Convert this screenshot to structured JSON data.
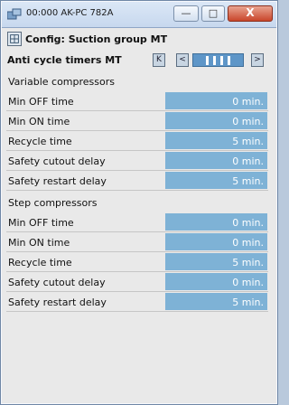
{
  "window": {
    "title": "00:000 AK-PC 782A",
    "min_glyph": "—",
    "max_glyph": "□",
    "close_glyph": "X"
  },
  "config": {
    "title": "Config: Suction group MT"
  },
  "nav": {
    "title": "Anti cycle timers MT",
    "first_glyph": "K",
    "prev_glyph": "<",
    "next_glyph": ">"
  },
  "variable": {
    "header": "Variable compressors",
    "rows": [
      {
        "label": "Min OFF time",
        "value": "0 min."
      },
      {
        "label": "Min ON time",
        "value": "0 min."
      },
      {
        "label": "Recycle time",
        "value": "5 min."
      },
      {
        "label": "Safety cutout delay",
        "value": "0 min."
      },
      {
        "label": "Safety restart delay",
        "value": "5 min."
      }
    ]
  },
  "step": {
    "header": "Step compressors",
    "rows": [
      {
        "label": "Min OFF time",
        "value": "0 min."
      },
      {
        "label": "Min ON time",
        "value": "0 min."
      },
      {
        "label": "Recycle time",
        "value": "5 min."
      },
      {
        "label": "Safety cutout delay",
        "value": "0 min."
      },
      {
        "label": "Safety restart delay",
        "value": "5 min."
      }
    ]
  }
}
